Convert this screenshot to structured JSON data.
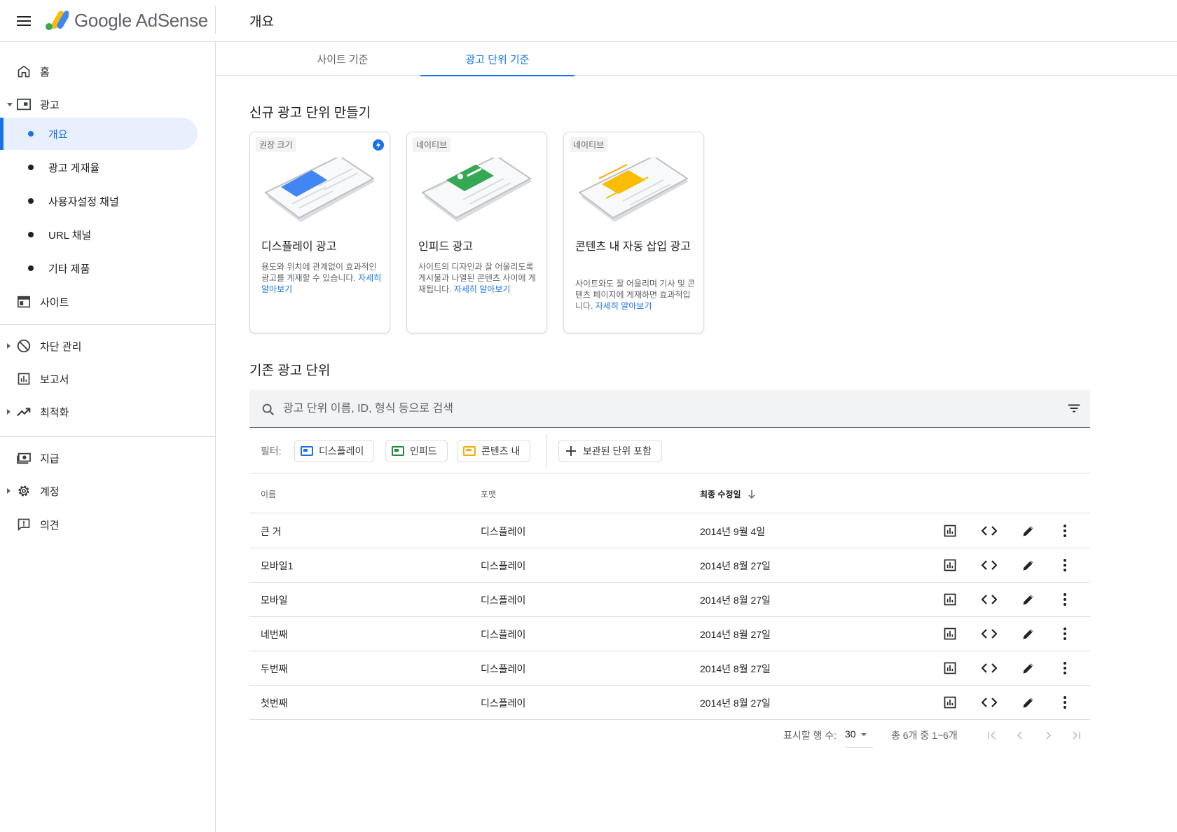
{
  "header": {
    "logo_text": "Google AdSense",
    "page_title": "개요"
  },
  "sidebar": {
    "items": [
      {
        "label": "홈",
        "icon": "home-icon"
      },
      {
        "label": "광고",
        "icon": "ads-icon"
      },
      {
        "label": "개요",
        "icon": "dot"
      },
      {
        "label": "광고 게재율",
        "icon": "dot"
      },
      {
        "label": "사용자설정 채널",
        "icon": "dot"
      },
      {
        "label": "URL 채널",
        "icon": "dot"
      },
      {
        "label": "기타 제품",
        "icon": "dot"
      },
      {
        "label": "사이트",
        "icon": "sites-icon"
      },
      {
        "label": "차단 관리",
        "icon": "block-icon"
      },
      {
        "label": "보고서",
        "icon": "reports-icon"
      },
      {
        "label": "최적화",
        "icon": "trending-icon"
      },
      {
        "label": "지급",
        "icon": "payments-icon"
      },
      {
        "label": "계정",
        "icon": "gear-icon"
      },
      {
        "label": "의견",
        "icon": "feedback-icon"
      }
    ]
  },
  "tabs": [
    {
      "label": "사이트 기준",
      "active": false
    },
    {
      "label": "광고 단위 기준",
      "active": true
    }
  ],
  "new_section_title": "신규 광고 단위 만들기",
  "cards": [
    {
      "tag": "권장 크기",
      "title": "디스플레이 광고",
      "desc": "용도와 위치에 관계없이 효과적인 광고를 게재할 수 있습니다.",
      "link": "자세히 알아보기",
      "color": "#4285f4"
    },
    {
      "tag": "네이티브",
      "title": "인피드 광고",
      "desc": "사이트의 디자인과 잘 어울리도록 게시물과 나열된 콘텐츠 사이에 게재됩니다.",
      "link": "자세히 알아보기",
      "color": "#34a853"
    },
    {
      "tag": "네이티브",
      "title": "콘텐츠 내 자동 삽입 광고",
      "desc": "사이트와도 잘 어울리며 기사 및 콘텐츠 페이지에 게재하면 효과적입니다.",
      "link": "자세히 알아보기",
      "color": "#fbbc04"
    }
  ],
  "existing_section_title": "기존 광고 단위",
  "search": {
    "placeholder": "광고 단위 이름, ID, 형식 등으로 검색"
  },
  "filters": {
    "label": "필터:",
    "chips": [
      {
        "label": "디스플레이",
        "color": "#1a73e8"
      },
      {
        "label": "인피드",
        "color": "#1e8e3e"
      },
      {
        "label": "콘텐츠 내",
        "color": "#f9ab00"
      }
    ],
    "archived": "보관된 단위 포함"
  },
  "table": {
    "headers": {
      "name": "이름",
      "format": "포맷",
      "modified": "최종 수정일"
    },
    "rows": [
      {
        "name": "큰 거",
        "format": "디스플레이",
        "modified": "2014년 9월 4일"
      },
      {
        "name": "모바일1",
        "format": "디스플레이",
        "modified": "2014년 8월 27일"
      },
      {
        "name": "모바일",
        "format": "디스플레이",
        "modified": "2014년 8월 27일"
      },
      {
        "name": "네번째",
        "format": "디스플레이",
        "modified": "2014년 8월 27일"
      },
      {
        "name": "두번째",
        "format": "디스플레이",
        "modified": "2014년 8월 27일"
      },
      {
        "name": "첫번째",
        "format": "디스플레이",
        "modified": "2014년 8월 27일"
      }
    ]
  },
  "pagination": {
    "rows_label": "표시할 행 수:",
    "rows_value": "30",
    "range": "총 6개 중 1~6개"
  },
  "colors": {
    "accent": "#1a73e8",
    "active_bg": "#e8f0fe"
  }
}
